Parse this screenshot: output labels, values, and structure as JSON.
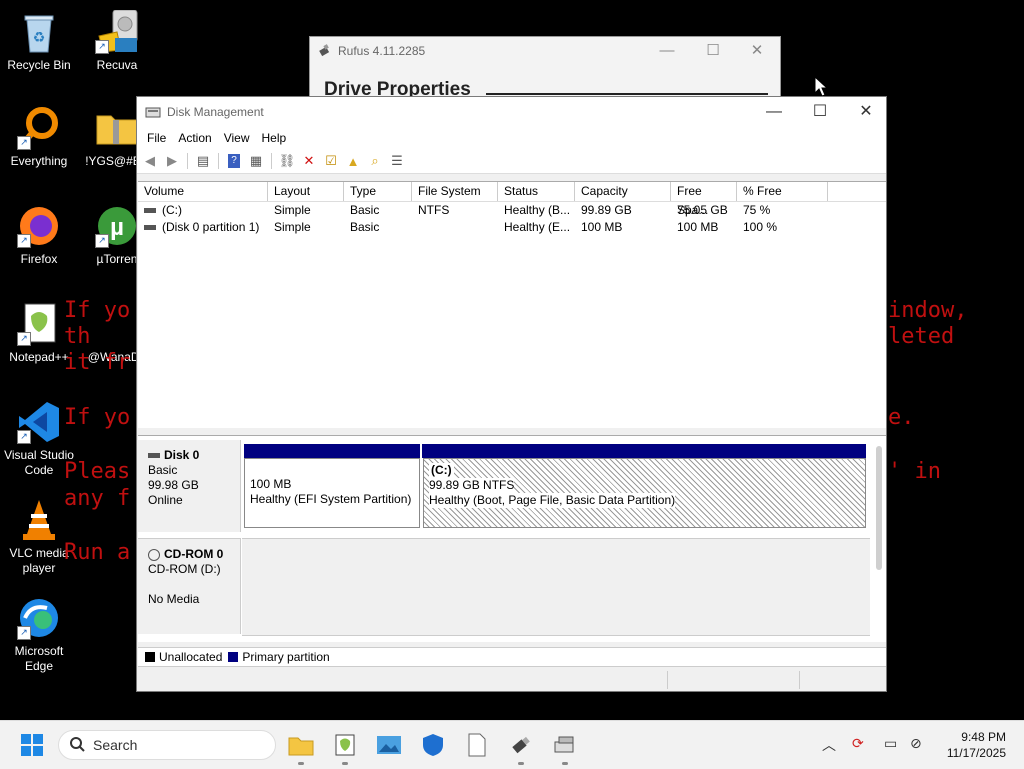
{
  "desktop": {
    "icons": [
      {
        "label": "Recycle Bin"
      },
      {
        "label": "Recuva"
      },
      {
        "label": "Everything"
      },
      {
        "label": "!YGS@#EB"
      },
      {
        "label": "Firefox"
      },
      {
        "label": "µTorren"
      },
      {
        "label": "Notepad++"
      },
      {
        "label": "@WanaDe"
      },
      {
        "label": "Visual Studio Code"
      },
      {
        "label": "VLC media player"
      },
      {
        "label": "Microsoft Edge"
      }
    ],
    "ransom_lines": [
      "If yo",
      "th",
      "it fr",
      "If yo",
      "Pleas",
      "any f",
      "Run a",
      "indow,",
      "leted",
      "e.",
      "' in"
    ]
  },
  "rufus": {
    "title": "Rufus 4.11.2285",
    "heading": "Drive Properties"
  },
  "disk_management": {
    "title": "Disk Management",
    "menu": [
      "File",
      "Action",
      "View",
      "Help"
    ],
    "columns": [
      "Volume",
      "Layout",
      "Type",
      "File System",
      "Status",
      "Capacity",
      "Free Spa...",
      "% Free"
    ],
    "volumes": [
      [
        "(C:)",
        "Simple",
        "Basic",
        "NTFS",
        "Healthy (B...",
        "99.89 GB",
        "75.05 GB",
        "75 %"
      ],
      [
        "(Disk 0 partition 1)",
        "Simple",
        "Basic",
        "",
        "Healthy (E...",
        "100 MB",
        "100 MB",
        "100 %"
      ]
    ],
    "disks": [
      {
        "name": "Disk 0",
        "type": "Basic",
        "size": "99.98 GB",
        "status": "Online"
      },
      {
        "name": "CD-ROM 0",
        "type": "CD-ROM (D:)",
        "size": "",
        "status": "No Media"
      }
    ],
    "partitions": [
      {
        "name": "",
        "size": "100 MB",
        "status": "Healthy (EFI System Partition)"
      },
      {
        "name": "(C:)",
        "size": "99.89 GB NTFS",
        "status": "Healthy (Boot, Page File, Basic Data Partition)"
      }
    ],
    "legend": [
      {
        "label": "Unallocated",
        "color": "#000000"
      },
      {
        "label": "Primary partition",
        "color": "#000080"
      }
    ]
  },
  "taskbar": {
    "search_placeholder": "Search",
    "time": "9:48 PM",
    "date": "11/17/2025"
  }
}
